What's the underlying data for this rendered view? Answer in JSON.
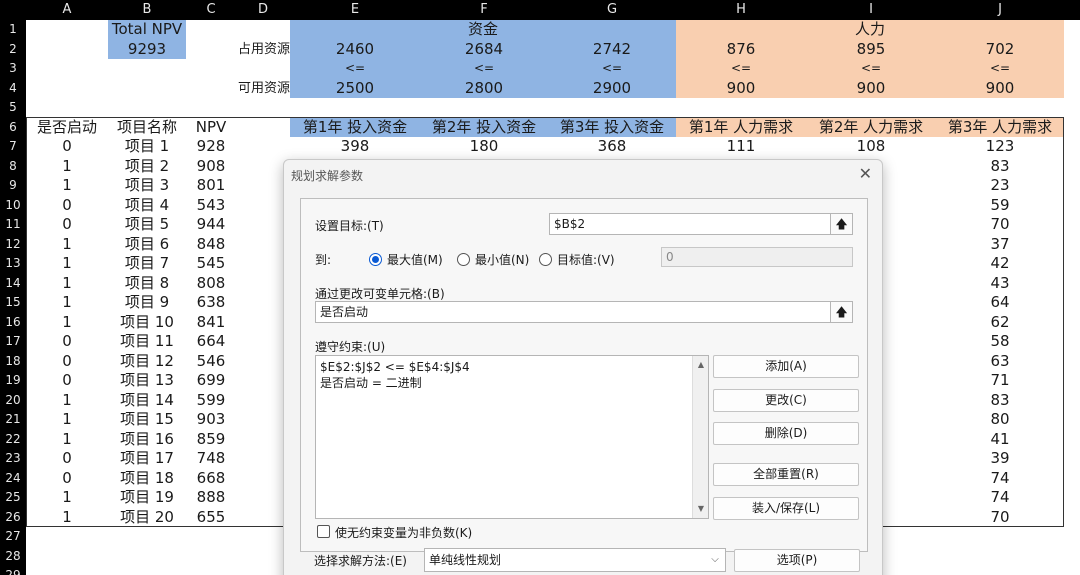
{
  "columns": [
    "A",
    "B",
    "C",
    "D",
    "E",
    "F",
    "G",
    "H",
    "I",
    "J"
  ],
  "rows": [
    "1",
    "2",
    "3",
    "4",
    "5",
    "6",
    "7",
    "8",
    "9",
    "10",
    "11",
    "12",
    "13",
    "14",
    "15",
    "16",
    "17",
    "18",
    "19",
    "20",
    "21",
    "22",
    "23",
    "24",
    "25",
    "26",
    "27",
    "28",
    "29"
  ],
  "top": {
    "total_npv_label": "Total NPV",
    "total_npv_value": "9293",
    "fund_header": "资金",
    "labor_header": "人力",
    "occupied_label": "占用资源",
    "available_label": "可用资源",
    "occupied": [
      "2460",
      "2684",
      "2742",
      "876",
      "895",
      "702"
    ],
    "le": [
      "<=",
      "<=",
      "<=",
      "<=",
      "<=",
      "<="
    ],
    "available": [
      "2500",
      "2800",
      "2900",
      "900",
      "900",
      "900"
    ]
  },
  "table": {
    "headers": [
      "是否启动",
      "项目名称",
      "NPV",
      "第1年 投入资金",
      "第2年 投入资金",
      "第3年 投入资金",
      "第1年 人力需求",
      "第2年 人力需求",
      "第3年 人力需求"
    ],
    "start": [
      "0",
      "1",
      "1",
      "0",
      "0",
      "1",
      "1",
      "1",
      "1",
      "1",
      "0",
      "0",
      "0",
      "1",
      "1",
      "1",
      "0",
      "0",
      "1",
      "1"
    ],
    "names": [
      "项目 1",
      "项目 2",
      "项目 3",
      "项目 4",
      "项目 5",
      "项目 6",
      "项目 7",
      "项目 8",
      "项目 9",
      "项目 10",
      "项目 11",
      "项目 12",
      "项目 13",
      "项目 14",
      "项目 15",
      "项目 16",
      "项目 17",
      "项目 18",
      "项目 19",
      "项目 20"
    ],
    "npv": [
      "928",
      "908",
      "801",
      "543",
      "944",
      "848",
      "545",
      "808",
      "638",
      "841",
      "664",
      "546",
      "699",
      "599",
      "903",
      "859",
      "748",
      "668",
      "888",
      "655"
    ],
    "row7": [
      "398",
      "180",
      "368",
      "111",
      "108"
    ],
    "labor3": [
      "123",
      "83",
      "23",
      "59",
      "70",
      "37",
      "42",
      "43",
      "64",
      "62",
      "58",
      "63",
      "71",
      "83",
      "80",
      "41",
      "39",
      "74",
      "74",
      "70"
    ]
  },
  "dialog": {
    "title": "规划求解参数",
    "close": "✕",
    "objective_label": "设置目标:(T)",
    "objective_value": "$B$2",
    "ref_icon": "🡅",
    "to_label": "到:",
    "radio_max": "最大值(M)",
    "radio_min": "最小值(N)",
    "radio_target": "目标值:(V)",
    "target_value": "0",
    "variable_label": "通过更改可变单元格:(B)",
    "variable_value": "是否启动",
    "constraints_label": "遵守约束:(U)",
    "constraints": [
      "$E$2:$J$2 <= $E$4:$J$4",
      "是否启动 = 二进制"
    ],
    "btn_add": "添加(A)",
    "btn_change": "更改(C)",
    "btn_delete": "删除(D)",
    "btn_reset": "全部重置(R)",
    "btn_load": "装入/保存(L)",
    "nonneg_label": "使无约束变量为非负数(K)",
    "method_label": "选择求解方法:(E)",
    "method_value": "单纯线性规划",
    "btn_options": "选项(P)"
  }
}
